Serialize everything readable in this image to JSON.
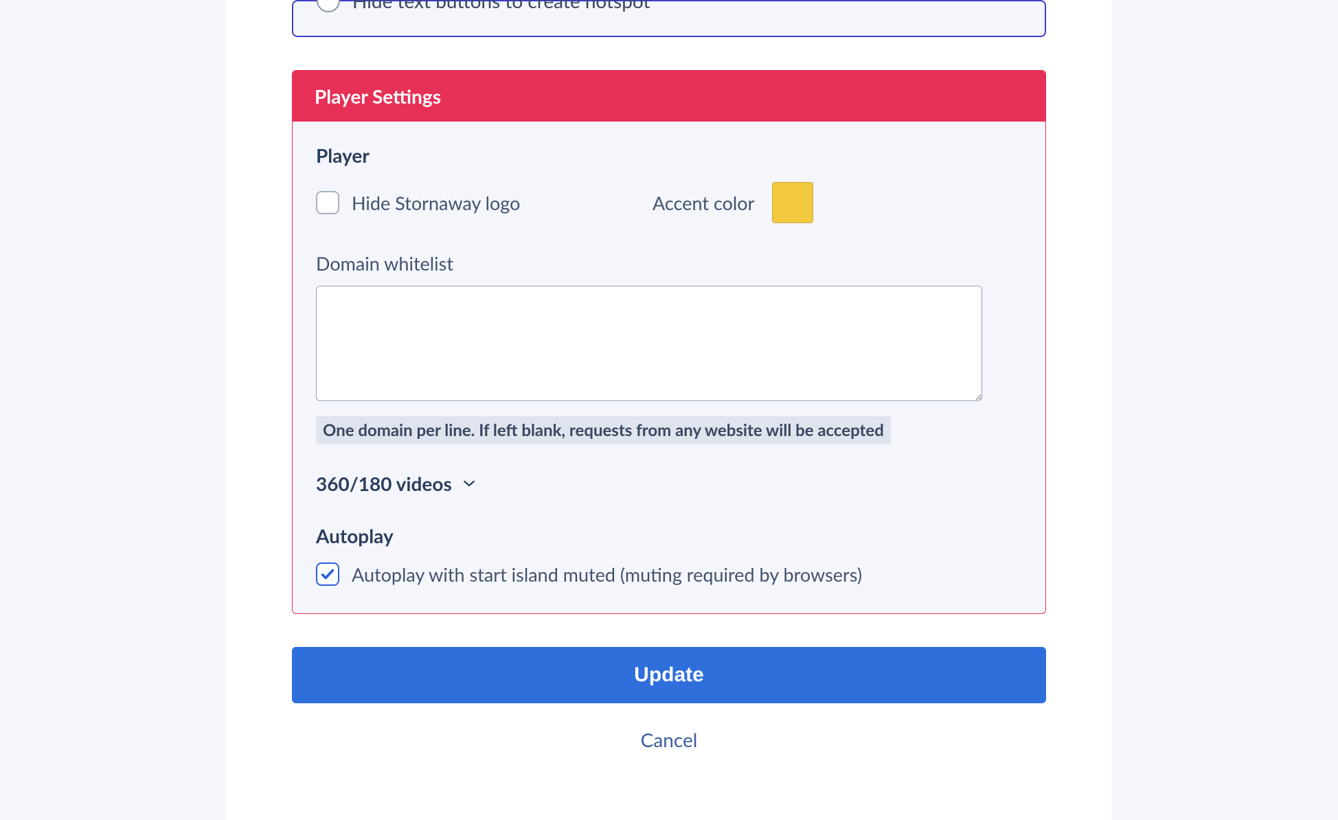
{
  "top_section": {
    "hotspot_radio_label": "Hide text buttons to create hotspot"
  },
  "player_settings": {
    "header": "Player Settings",
    "player_section_title": "Player",
    "hide_logo_label": "Hide Stornaway logo",
    "hide_logo_checked": false,
    "accent_color_label": "Accent color",
    "accent_color_value": "#f2c83f",
    "domain_whitelist_label": "Domain whitelist",
    "domain_whitelist_value": "",
    "domain_whitelist_helper": "One domain per line. If left blank, requests from any website will be accepted",
    "video_section_label": "360/180 videos",
    "autoplay_section_title": "Autoplay",
    "autoplay_label": "Autoplay with start island muted (muting required by browsers)",
    "autoplay_checked": true
  },
  "actions": {
    "update_label": "Update",
    "cancel_label": "Cancel"
  }
}
